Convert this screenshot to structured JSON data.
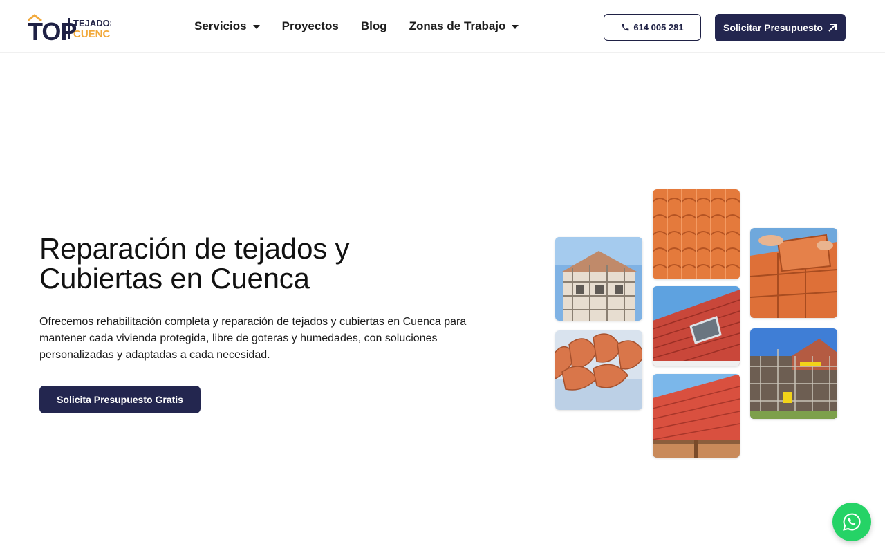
{
  "logo": {
    "mark": "TOP",
    "line1": "TEJADOS",
    "line2": "CUENCA",
    "dark_color": "#1f2145",
    "accent_color": "#f2a93b"
  },
  "nav": {
    "items": [
      {
        "label": "Servicios",
        "has_dropdown": true
      },
      {
        "label": "Proyectos",
        "has_dropdown": false
      },
      {
        "label": "Blog",
        "has_dropdown": false
      },
      {
        "label": "Zonas de Trabajo",
        "has_dropdown": true
      }
    ]
  },
  "header_actions": {
    "phone_label": "614 005 281",
    "phone_icon": "phone-icon",
    "quote_label": "Solicitar Presupuesto",
    "quote_icon": "arrow-up-right-icon"
  },
  "hero": {
    "title_line1": "Reparación de tejados y",
    "title_line2": "Cubiertas en Cuenca",
    "description": "Ofrecemos rehabilitación completa y reparación de tejados y cubiertas en Cuenca para mantener cada vivienda protegida, libre de goteras y humedades, con soluciones personalizadas y adaptadas a cada necesidad.",
    "cta_label": "Solicita Presupuesto Gratis"
  },
  "gallery": {
    "images": [
      {
        "name": "scaffolding-house-photo"
      },
      {
        "name": "curved-tiles-photo"
      },
      {
        "name": "orange-tiles-closeup-photo"
      },
      {
        "name": "red-roof-skylight-photo"
      },
      {
        "name": "red-roof-gutter-photo"
      },
      {
        "name": "hands-placing-tile-photo"
      },
      {
        "name": "building-scaffold-photo"
      }
    ]
  },
  "floating": {
    "whatsapp_icon": "whatsapp-icon"
  },
  "colors": {
    "primary": "#23264f",
    "whatsapp": "#25d366"
  }
}
